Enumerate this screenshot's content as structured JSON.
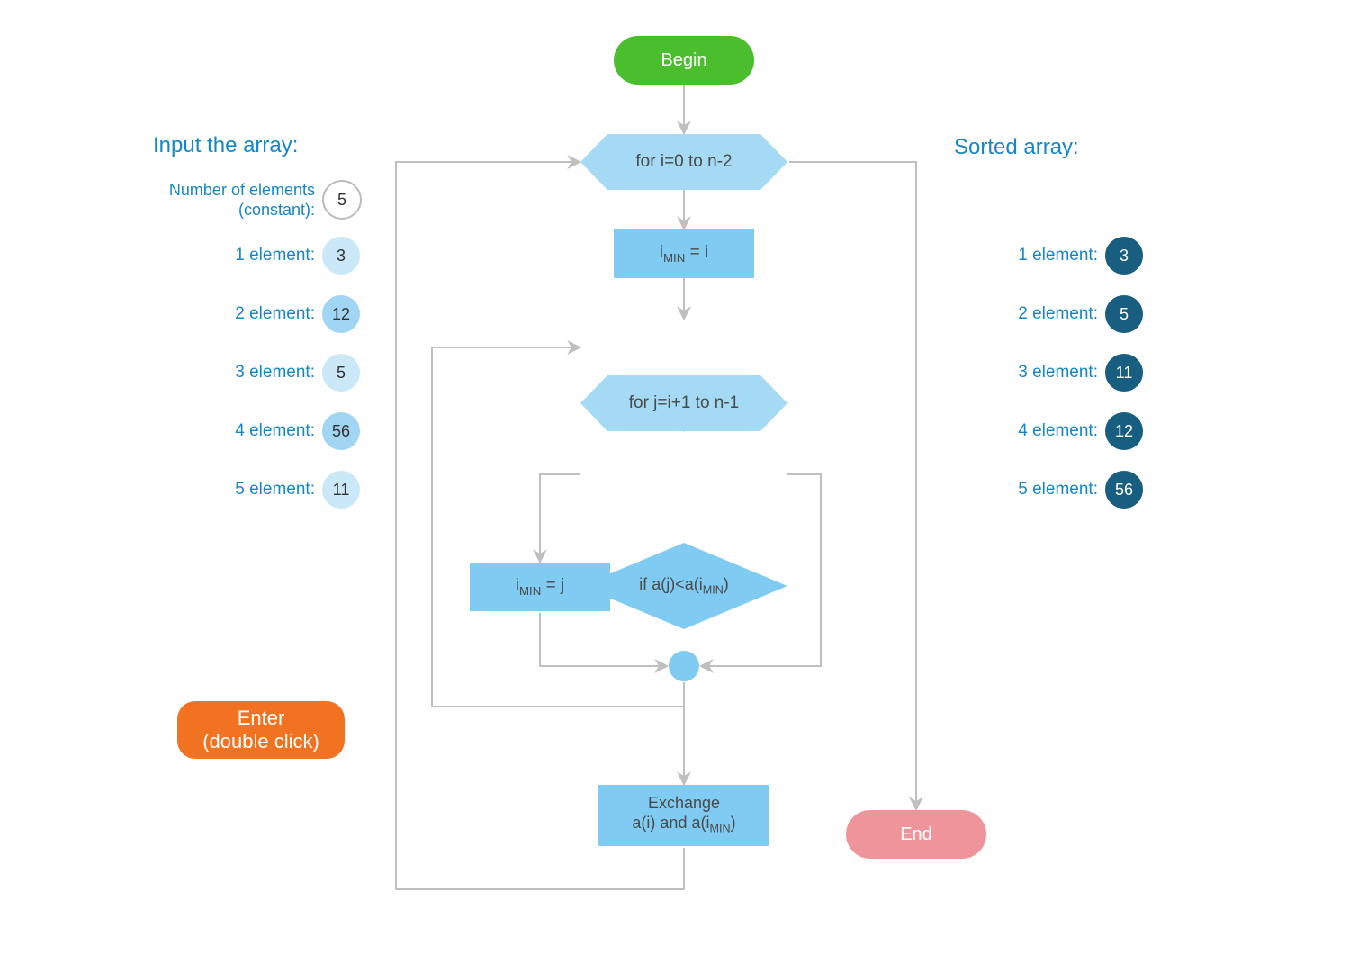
{
  "headings": {
    "input": "Input the array:",
    "output": "Sorted array:"
  },
  "input": {
    "count_label": "Number of elements (constant):",
    "count_value": "5",
    "rows": [
      {
        "label": "1 element:",
        "value": "3"
      },
      {
        "label": "2 element:",
        "value": "12"
      },
      {
        "label": "3 element:",
        "value": "5"
      },
      {
        "label": "4 element:",
        "value": "56"
      },
      {
        "label": "5 element:",
        "value": "11"
      }
    ]
  },
  "output": {
    "rows": [
      {
        "label": "1 element:",
        "value": "3"
      },
      {
        "label": "2 element:",
        "value": "5"
      },
      {
        "label": "3 element:",
        "value": "11"
      },
      {
        "label": "4 element:",
        "value": "12"
      },
      {
        "label": "5 element:",
        "value": "56"
      }
    ]
  },
  "enter": {
    "line1": "Enter",
    "line2": "(double click)"
  },
  "flow": {
    "begin": "Begin",
    "end": "End",
    "for_i": "for i=0 to n-2",
    "imin_eq_i_pre": "i",
    "imin_eq_i_sub": "MIN",
    "imin_eq_i_post": " = i",
    "for_j": "for j=i+1 to n-1",
    "cond_pre": "if a(j)<a(i",
    "cond_sub": "MIN",
    "cond_post": ")",
    "imin_eq_j_pre": "i",
    "imin_eq_j_sub": "MIN",
    "imin_eq_j_post": " = j",
    "exch_l1": "Exchange",
    "exch_l2_pre": "a(i) and a(i",
    "exch_l2_sub": "MIN",
    "exch_l2_post": ")"
  }
}
